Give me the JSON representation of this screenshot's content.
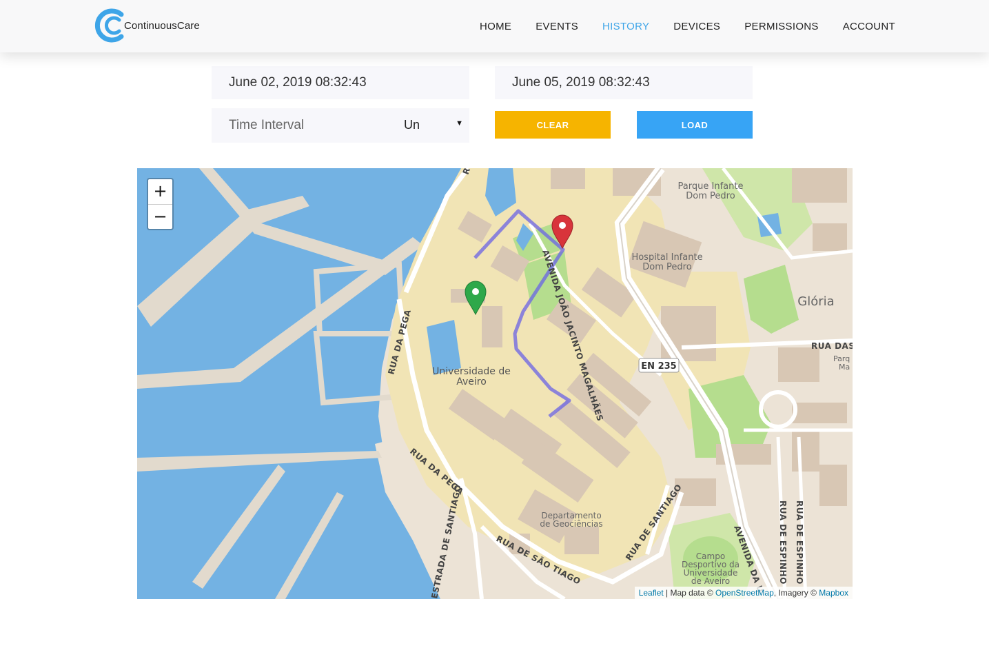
{
  "brand": {
    "name": "ContinuousCare",
    "logo_icon": "c-logo-icon",
    "accent": "#3ea5e8"
  },
  "nav": {
    "items": [
      {
        "label": "HOME",
        "active": false
      },
      {
        "label": "EVENTS",
        "active": false
      },
      {
        "label": "HISTORY",
        "active": true
      },
      {
        "label": "DEVICES",
        "active": false
      },
      {
        "label": "PERMISSIONS",
        "active": false
      },
      {
        "label": "ACCOUNT",
        "active": false
      }
    ]
  },
  "filters": {
    "from_date": "June 02, 2019 08:32:43",
    "to_date": "June 05, 2019 08:32:43",
    "interval_label": "Time Interval",
    "interval_value": "Un",
    "clear_label": "CLEAR",
    "load_label": "LOAD",
    "clear_color": "#f6b400",
    "load_color": "#37a4f5"
  },
  "map": {
    "zoom_in": "+",
    "zoom_out": "−",
    "labels": {
      "park": "Parque Infante",
      "park2": "Dom Pedro",
      "hospital": "Hospital Infante",
      "hospital2": "Dom Pedro",
      "gloria": "Glória",
      "univ": "Universidade de",
      "univ2": "Aveiro",
      "dept": "Departamento",
      "dept2": "de Geociências",
      "campo": "Campo",
      "campo2": "Desportivo da",
      "campo3": "Universidade",
      "campo4": "de Aveiro",
      "road_pega_1": "RUA DA PEGA",
      "road_pega_2": "RUA DA PEGA",
      "road_joao": "AVENIDA JOÃO JACINTO MAGALHÃES",
      "road_santiago": "RUA DE SANTIAGO",
      "road_saotiago": "RUA DE SÃO TIAGO",
      "road_estrada": "ESTRADA DE SANTIAGO",
      "road_en235": "EN 235",
      "road_avenida": "AVENIDA DA U",
      "road_espinho1": "RUA DE ESPINHO",
      "road_espinho2": "RUA DE ESPINHO",
      "road_das": "RUA DAS",
      "park_small": "Parq",
      "park_small2": "Ma",
      "r_top": "R"
    },
    "start_marker": {
      "icon": "green-pin-icon",
      "color": "#2ea84a"
    },
    "end_marker": {
      "icon": "red-pin-icon",
      "color": "#d8343b"
    },
    "route_color": "#6a63e6",
    "attribution": {
      "leaflet": "Leaflet",
      "sep1": " | Map data © ",
      "osm": "OpenStreetMap",
      "sep2": ", Imagery © ",
      "mapbox": "Mapbox"
    }
  }
}
